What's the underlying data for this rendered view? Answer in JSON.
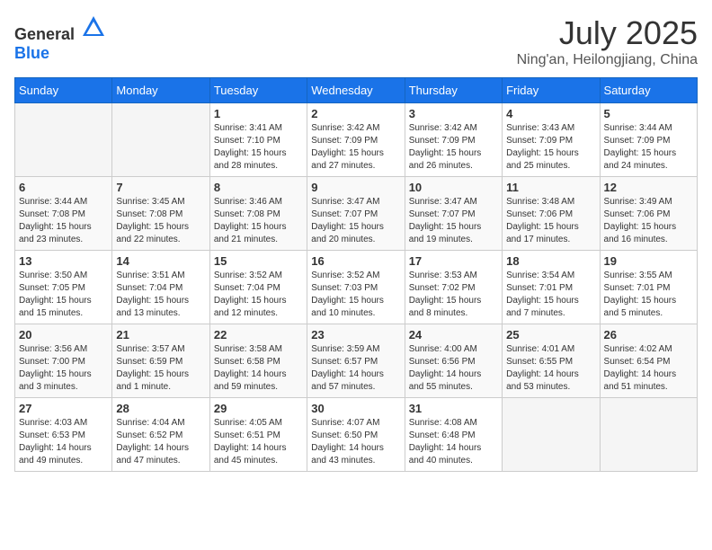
{
  "header": {
    "logo_general": "General",
    "logo_blue": "Blue",
    "month_year": "July 2025",
    "location": "Ning'an, Heilongjiang, China"
  },
  "weekdays": [
    "Sunday",
    "Monday",
    "Tuesday",
    "Wednesday",
    "Thursday",
    "Friday",
    "Saturday"
  ],
  "weeks": [
    [
      {
        "day": "",
        "info": ""
      },
      {
        "day": "",
        "info": ""
      },
      {
        "day": "1",
        "info": "Sunrise: 3:41 AM\nSunset: 7:10 PM\nDaylight: 15 hours\nand 28 minutes."
      },
      {
        "day": "2",
        "info": "Sunrise: 3:42 AM\nSunset: 7:09 PM\nDaylight: 15 hours\nand 27 minutes."
      },
      {
        "day": "3",
        "info": "Sunrise: 3:42 AM\nSunset: 7:09 PM\nDaylight: 15 hours\nand 26 minutes."
      },
      {
        "day": "4",
        "info": "Sunrise: 3:43 AM\nSunset: 7:09 PM\nDaylight: 15 hours\nand 25 minutes."
      },
      {
        "day": "5",
        "info": "Sunrise: 3:44 AM\nSunset: 7:09 PM\nDaylight: 15 hours\nand 24 minutes."
      }
    ],
    [
      {
        "day": "6",
        "info": "Sunrise: 3:44 AM\nSunset: 7:08 PM\nDaylight: 15 hours\nand 23 minutes."
      },
      {
        "day": "7",
        "info": "Sunrise: 3:45 AM\nSunset: 7:08 PM\nDaylight: 15 hours\nand 22 minutes."
      },
      {
        "day": "8",
        "info": "Sunrise: 3:46 AM\nSunset: 7:08 PM\nDaylight: 15 hours\nand 21 minutes."
      },
      {
        "day": "9",
        "info": "Sunrise: 3:47 AM\nSunset: 7:07 PM\nDaylight: 15 hours\nand 20 minutes."
      },
      {
        "day": "10",
        "info": "Sunrise: 3:47 AM\nSunset: 7:07 PM\nDaylight: 15 hours\nand 19 minutes."
      },
      {
        "day": "11",
        "info": "Sunrise: 3:48 AM\nSunset: 7:06 PM\nDaylight: 15 hours\nand 17 minutes."
      },
      {
        "day": "12",
        "info": "Sunrise: 3:49 AM\nSunset: 7:06 PM\nDaylight: 15 hours\nand 16 minutes."
      }
    ],
    [
      {
        "day": "13",
        "info": "Sunrise: 3:50 AM\nSunset: 7:05 PM\nDaylight: 15 hours\nand 15 minutes."
      },
      {
        "day": "14",
        "info": "Sunrise: 3:51 AM\nSunset: 7:04 PM\nDaylight: 15 hours\nand 13 minutes."
      },
      {
        "day": "15",
        "info": "Sunrise: 3:52 AM\nSunset: 7:04 PM\nDaylight: 15 hours\nand 12 minutes."
      },
      {
        "day": "16",
        "info": "Sunrise: 3:52 AM\nSunset: 7:03 PM\nDaylight: 15 hours\nand 10 minutes."
      },
      {
        "day": "17",
        "info": "Sunrise: 3:53 AM\nSunset: 7:02 PM\nDaylight: 15 hours\nand 8 minutes."
      },
      {
        "day": "18",
        "info": "Sunrise: 3:54 AM\nSunset: 7:01 PM\nDaylight: 15 hours\nand 7 minutes."
      },
      {
        "day": "19",
        "info": "Sunrise: 3:55 AM\nSunset: 7:01 PM\nDaylight: 15 hours\nand 5 minutes."
      }
    ],
    [
      {
        "day": "20",
        "info": "Sunrise: 3:56 AM\nSunset: 7:00 PM\nDaylight: 15 hours\nand 3 minutes."
      },
      {
        "day": "21",
        "info": "Sunrise: 3:57 AM\nSunset: 6:59 PM\nDaylight: 15 hours\nand 1 minute."
      },
      {
        "day": "22",
        "info": "Sunrise: 3:58 AM\nSunset: 6:58 PM\nDaylight: 14 hours\nand 59 minutes."
      },
      {
        "day": "23",
        "info": "Sunrise: 3:59 AM\nSunset: 6:57 PM\nDaylight: 14 hours\nand 57 minutes."
      },
      {
        "day": "24",
        "info": "Sunrise: 4:00 AM\nSunset: 6:56 PM\nDaylight: 14 hours\nand 55 minutes."
      },
      {
        "day": "25",
        "info": "Sunrise: 4:01 AM\nSunset: 6:55 PM\nDaylight: 14 hours\nand 53 minutes."
      },
      {
        "day": "26",
        "info": "Sunrise: 4:02 AM\nSunset: 6:54 PM\nDaylight: 14 hours\nand 51 minutes."
      }
    ],
    [
      {
        "day": "27",
        "info": "Sunrise: 4:03 AM\nSunset: 6:53 PM\nDaylight: 14 hours\nand 49 minutes."
      },
      {
        "day": "28",
        "info": "Sunrise: 4:04 AM\nSunset: 6:52 PM\nDaylight: 14 hours\nand 47 minutes."
      },
      {
        "day": "29",
        "info": "Sunrise: 4:05 AM\nSunset: 6:51 PM\nDaylight: 14 hours\nand 45 minutes."
      },
      {
        "day": "30",
        "info": "Sunrise: 4:07 AM\nSunset: 6:50 PM\nDaylight: 14 hours\nand 43 minutes."
      },
      {
        "day": "31",
        "info": "Sunrise: 4:08 AM\nSunset: 6:48 PM\nDaylight: 14 hours\nand 40 minutes."
      },
      {
        "day": "",
        "info": ""
      },
      {
        "day": "",
        "info": ""
      }
    ]
  ]
}
